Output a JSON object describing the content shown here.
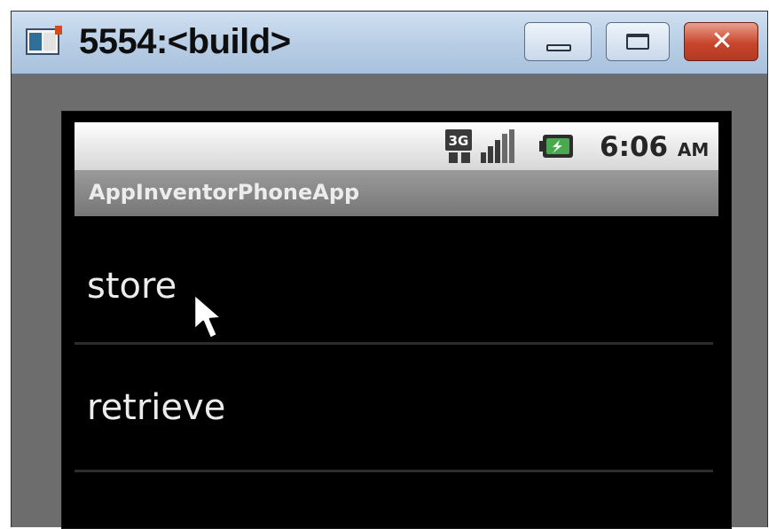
{
  "window": {
    "title": "5554:<build>",
    "icons": {
      "app": "emulator-app-icon",
      "minimize": "minimize-icon",
      "maximize": "maximize-icon",
      "close": "close-icon"
    }
  },
  "statusbar": {
    "network_label": "3G",
    "time": "6:06",
    "ampm": "AM",
    "icons": [
      "3g-icon",
      "signal-icon",
      "battery-icon"
    ]
  },
  "app": {
    "title": "AppInventorPhoneApp"
  },
  "list": {
    "items": [
      {
        "label": "store"
      },
      {
        "label": "retrieve"
      }
    ]
  },
  "colors": {
    "screen_background": "#000000",
    "app_titlebar": "#8a8a8a",
    "list_text": "#ececec",
    "close_button": "#c8452c"
  }
}
